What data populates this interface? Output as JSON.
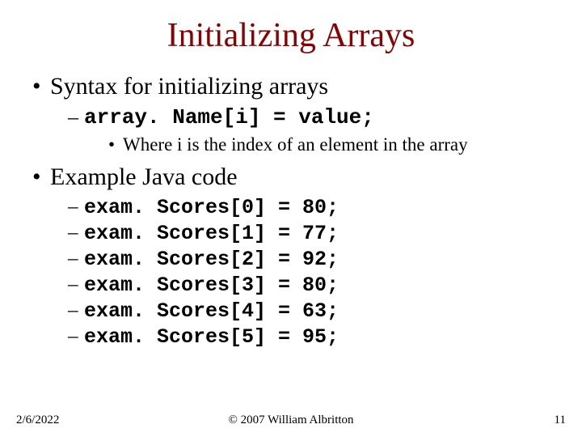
{
  "title": "Initializing Arrays",
  "bullets": {
    "syntax_header": "Syntax for initializing arrays",
    "syntax_code": "array. Name[i] = value;",
    "syntax_note": "Where i is the index of an element in the array",
    "example_header": "Example Java code",
    "code": [
      "exam. Scores[0] = 80;",
      "exam. Scores[1] = 77;",
      "exam. Scores[2] = 92;",
      "exam. Scores[3] = 80;",
      "exam. Scores[4] = 63;",
      "exam. Scores[5] = 95;"
    ]
  },
  "footer": {
    "date": "2/6/2022",
    "copyright": "© 2007 William Albritton",
    "page": "11"
  }
}
